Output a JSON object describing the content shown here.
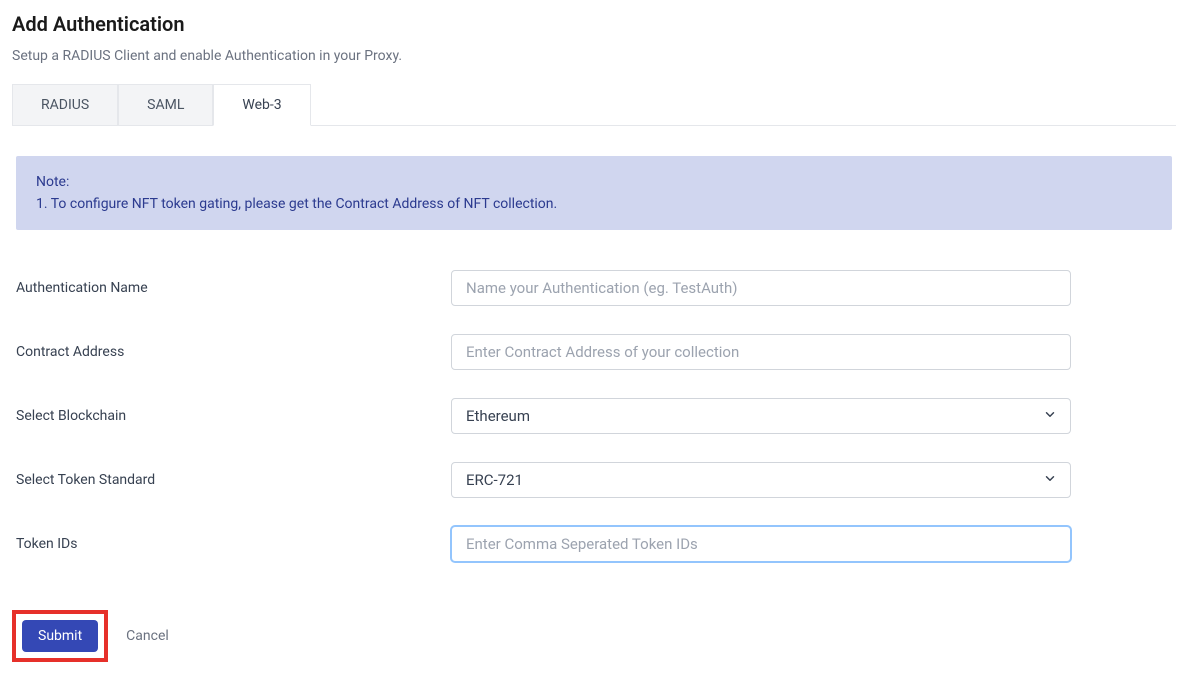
{
  "header": {
    "title": "Add Authentication",
    "subtitle": "Setup a RADIUS Client and enable Authentication in your Proxy."
  },
  "tabs": [
    {
      "label": "RADIUS",
      "active": false
    },
    {
      "label": "SAML",
      "active": false
    },
    {
      "label": "Web-3",
      "active": true
    }
  ],
  "note": {
    "title": "Note:",
    "line1": "1. To configure NFT token gating, please get the Contract Address of NFT collection."
  },
  "form": {
    "authName": {
      "label": "Authentication Name",
      "placeholder": "Name your Authentication (eg. TestAuth)",
      "value": ""
    },
    "contractAddress": {
      "label": "Contract Address",
      "placeholder": "Enter Contract Address of your collection",
      "value": ""
    },
    "blockchain": {
      "label": "Select Blockchain",
      "value": "Ethereum"
    },
    "tokenStandard": {
      "label": "Select Token Standard",
      "value": "ERC-721"
    },
    "tokenIds": {
      "label": "Token IDs",
      "placeholder": "Enter Comma Seperated Token IDs",
      "value": ""
    }
  },
  "actions": {
    "submit": "Submit",
    "cancel": "Cancel"
  }
}
